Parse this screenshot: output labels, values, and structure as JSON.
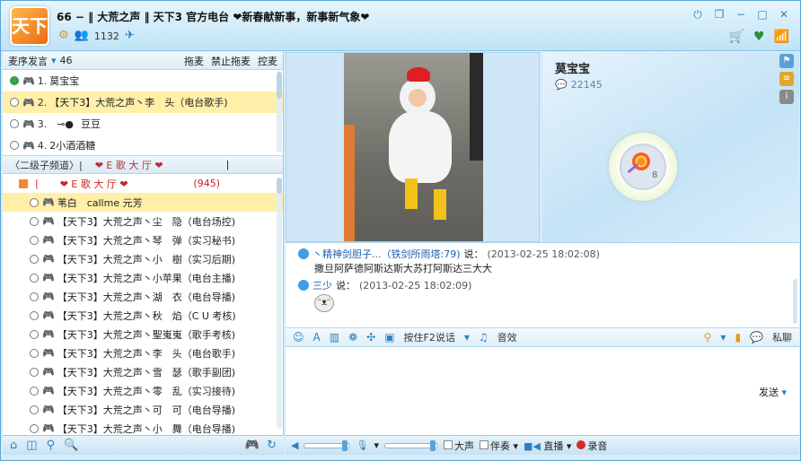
{
  "titlebar": {
    "logo_text": "天下",
    "room_title": "66 − ‖ 大荒之声 ‖ 天下3 官方电台 ❤新春献新事，新事新气象❤",
    "online_count": "1132"
  },
  "queue": {
    "title": "麦序发言",
    "count": "46",
    "actions": [
      "拖麦",
      "禁止拖麦",
      "控麦"
    ],
    "items": [
      {
        "index": "1.",
        "name": "莫宝宝",
        "state": "on",
        "selected": false
      },
      {
        "index": "2.",
        "name": "【天下3】大荒之声丶李　头（电台歌手)",
        "state": "off",
        "selected": true
      },
      {
        "index": "3.",
        "name": "豆豆",
        "state": "off",
        "selected": false
      },
      {
        "index": "4.",
        "name": "2小酒酒糖",
        "state": "off",
        "selected": false
      }
    ]
  },
  "channel": {
    "sub_label": "〈二级子频道〉|",
    "hall_label": "❤ E 歌 大 厅 ❤",
    "hall_row_label": "❤ E 歌 大 厅 ❤",
    "hall_count": "(945)"
  },
  "members": [
    {
      "name": "苇白　callme 元芳",
      "hi": true,
      "mic": "yellow"
    },
    {
      "name": "【天下3】大荒之声丶尘　隐（电台场控)",
      "hi": false,
      "mic": "pink"
    },
    {
      "name": "【天下3】大荒之声丶琴　弹（实习秘书)",
      "hi": false,
      "mic": "blue"
    },
    {
      "name": "【天下3】大荒之声丶小　樹（实习后期)",
      "hi": false,
      "mic": "blue"
    },
    {
      "name": "【天下3】大荒之声丶小苹果（电台主播)",
      "hi": false,
      "mic": "blue"
    },
    {
      "name": "【天下3】大荒之声丶湖　衣（电台导播)",
      "hi": false,
      "mic": "blue"
    },
    {
      "name": "【天下3】大荒之声丶秋　焰（C U 考核)",
      "hi": false,
      "mic": "pink"
    },
    {
      "name": "【天下3】大荒之声丶聖嵬嵬（歌手考核)",
      "hi": false,
      "mic": "blue"
    },
    {
      "name": "【天下3】大荒之声丶李　头（电台歌手)",
      "hi": false,
      "mic": "blue"
    },
    {
      "name": "【天下3】大荒之声丶雪　瑟（歌手副团)",
      "hi": false,
      "mic": "blue"
    },
    {
      "name": "【天下3】大荒之声丶零　乱（实习接待)",
      "hi": false,
      "mic": "blue"
    },
    {
      "name": "【天下3】大荒之声丶可　可（电台导播)",
      "hi": false,
      "mic": "pink"
    },
    {
      "name": "【天下3】大荒之声丶小　舞（电台导播)",
      "hi": false,
      "mic": "blue"
    }
  ],
  "profile": {
    "name": "莫宝宝",
    "uid": "22145",
    "gift_count": "8"
  },
  "chat": [
    {
      "sender": "丶精神剑胆子...（铁剑所雨塔:79)",
      "said": "说：",
      "time": "(2013-02-25 18:02:08)",
      "text": "撒旦阿萨德阿斯达斯大苏打阿斯达三大大"
    },
    {
      "sender": "三少",
      "said": "说：",
      "time": "(2013-02-25 18:02:09)",
      "text": ""
    }
  ],
  "toolbar": {
    "ptt_label": "按住F2说话",
    "music_label": "音效",
    "private_label": "私聊",
    "send_label": "发送"
  },
  "status": {
    "mic_volume": 0.92,
    "speaker_volume": 0.9,
    "loud_label": "大声",
    "accompany_label": "伴奏",
    "live_label": "直播",
    "record_label": "录音"
  }
}
